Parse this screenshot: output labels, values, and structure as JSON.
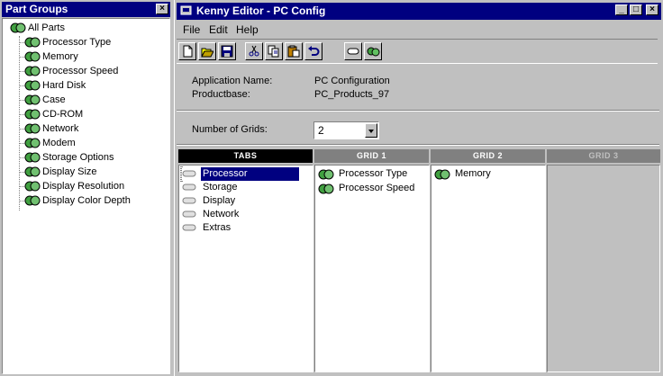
{
  "part_groups": {
    "title": "Part Groups",
    "close_icon": "close-icon",
    "root": "All Parts",
    "items": [
      "Processor Type",
      "Memory",
      "Processor Speed",
      "Hard Disk",
      "Case",
      "CD-ROM",
      "Network",
      "Modem",
      "Storage Options",
      "Display Size",
      "Display Resolution",
      "Display Color Depth"
    ]
  },
  "editor": {
    "title": "Kenny Editor - PC Config",
    "menu": {
      "file": "File",
      "edit": "Edit",
      "help": "Help"
    },
    "toolbar_icons": [
      "new-icon",
      "open-icon",
      "save-icon",
      "cut-icon",
      "copy-icon",
      "paste-icon",
      "undo-icon",
      "tab-icon",
      "part-icon"
    ],
    "info": {
      "app_name_label": "Application Name:",
      "app_name_value": "PC Configuration",
      "productbase_label": "Productbase:",
      "productbase_value": "PC_Products_97"
    },
    "grids": {
      "label": "Number of Grids:",
      "value": "2"
    },
    "columns": {
      "tabs": "TABS",
      "grid1": "GRID 1",
      "grid2": "GRID 2",
      "grid3": "GRID 3"
    },
    "tabs": [
      "Processor",
      "Storage",
      "Display",
      "Network",
      "Extras"
    ],
    "selected_tab": "Processor",
    "grid1_items": [
      "Processor Type",
      "Processor Speed"
    ],
    "grid2_items": [
      "Memory"
    ],
    "grid3_items": []
  },
  "colors": {
    "titlebar": "#000080",
    "face": "#c0c0c0",
    "part_icon": "#40a040"
  }
}
